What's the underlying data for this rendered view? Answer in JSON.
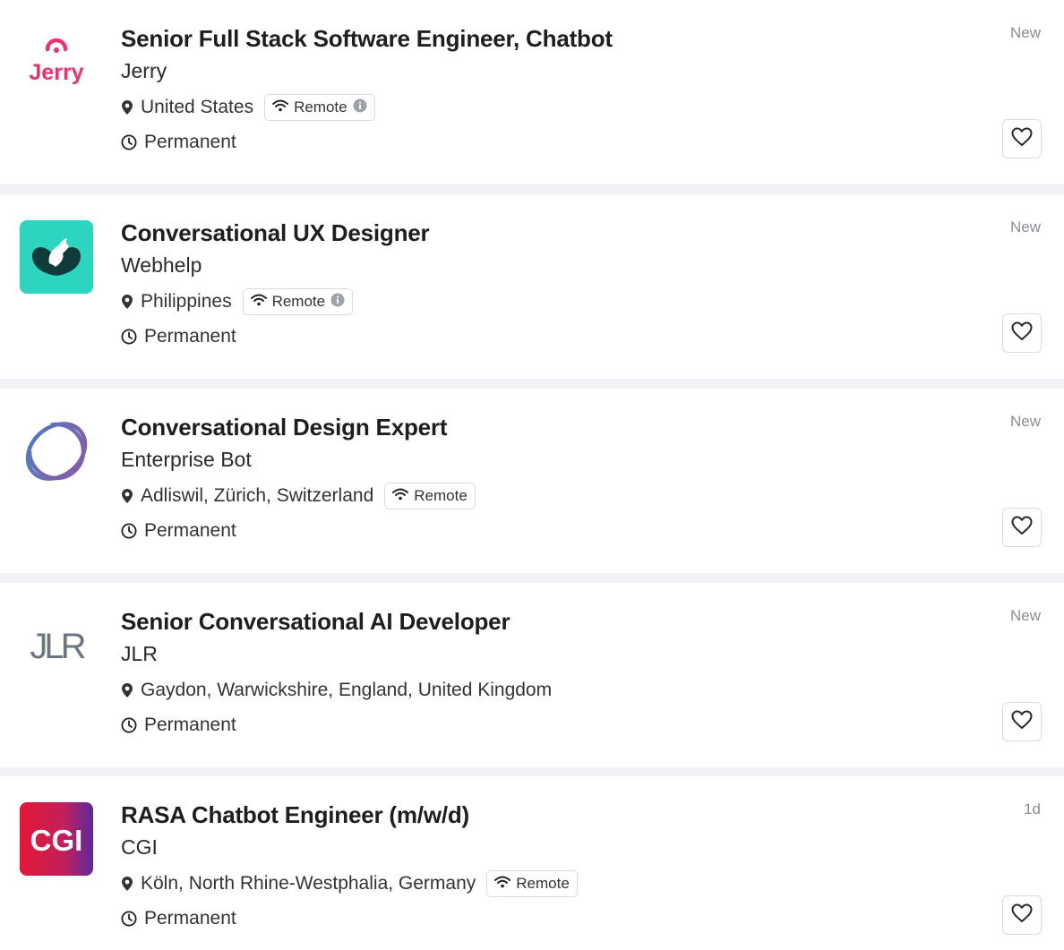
{
  "jobs": [
    {
      "title": "Senior Full Stack Software Engineer, Chatbot",
      "company": "Jerry",
      "location": "United States",
      "remote_label": "Remote",
      "job_type": "Permanent",
      "posted": "New",
      "logo_text": "Jerry",
      "logo_color": "#e8336f"
    },
    {
      "title": "Conversational UX Designer",
      "company": "Webhelp",
      "location": "Philippines",
      "remote_label": "Remote",
      "job_type": "Permanent",
      "posted": "New",
      "logo_color": "#2dd4bf"
    },
    {
      "title": "Conversational Design Expert",
      "company": "Enterprise Bot",
      "location": "Adliswil, Zürich, Switzerland",
      "remote_label": "Remote",
      "job_type": "Permanent",
      "posted": "New",
      "logo_color": "#5b6fb0"
    },
    {
      "title": "Senior Conversational AI Developer",
      "company": "JLR",
      "location": "Gaydon, Warwickshire, England, United Kingdom",
      "job_type": "Permanent",
      "posted": "New",
      "logo_text": "JLR",
      "logo_color": "#6b7680"
    },
    {
      "title": "RASA Chatbot Engineer (m/w/d)",
      "company": "CGI",
      "location": "Köln, North Rhine-Westphalia, Germany",
      "remote_label": "Remote",
      "job_type": "Permanent",
      "posted": "1d",
      "logo_text": "CGI",
      "logo_color": "#e31937"
    }
  ]
}
